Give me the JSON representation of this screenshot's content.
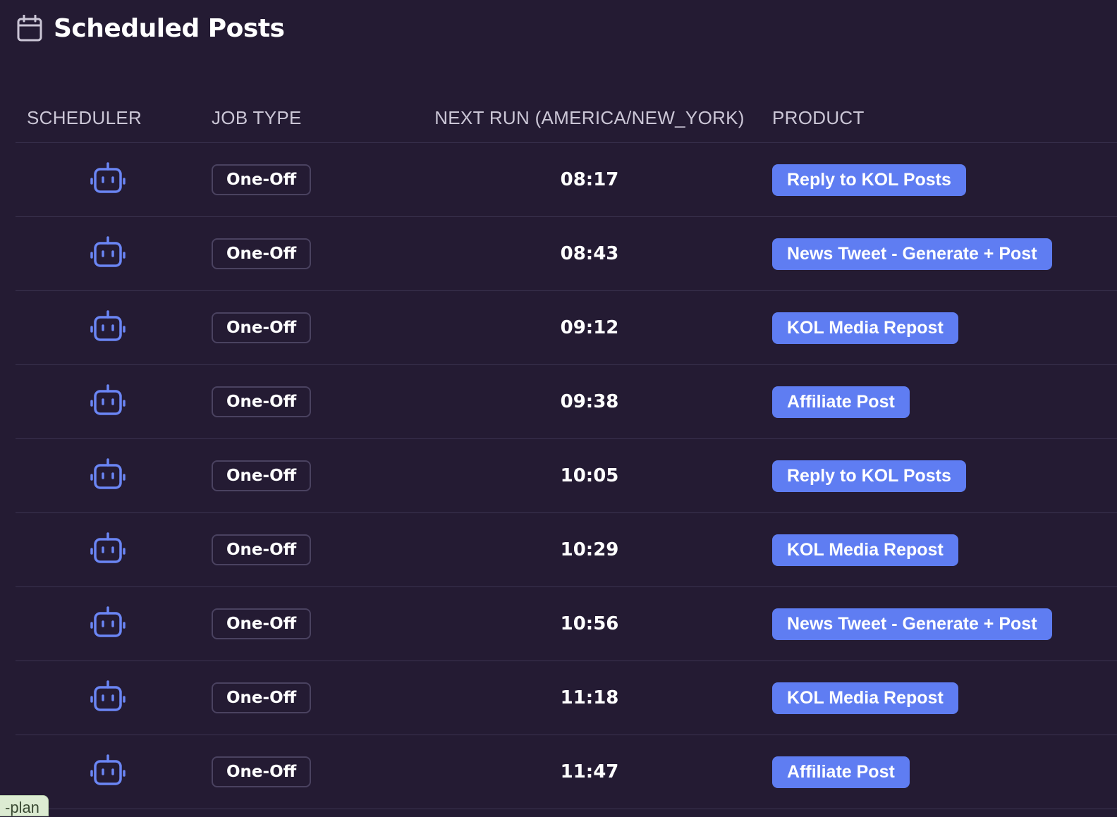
{
  "header": {
    "title": "Scheduled Posts",
    "icon": "calendar-icon"
  },
  "table": {
    "columns": [
      "SCHEDULER",
      "JOB TYPE",
      "NEXT RUN (AMERICA/NEW_YORK)",
      "PRODUCT"
    ],
    "rows": [
      {
        "scheduler_icon": "robot-icon",
        "job_type": "One-Off",
        "next_run": "08:17",
        "product": "Reply to KOL Posts"
      },
      {
        "scheduler_icon": "robot-icon",
        "job_type": "One-Off",
        "next_run": "08:43",
        "product": "News Tweet - Generate + Post"
      },
      {
        "scheduler_icon": "robot-icon",
        "job_type": "One-Off",
        "next_run": "09:12",
        "product": "KOL Media Repost"
      },
      {
        "scheduler_icon": "robot-icon",
        "job_type": "One-Off",
        "next_run": "09:38",
        "product": "Affiliate Post"
      },
      {
        "scheduler_icon": "robot-icon",
        "job_type": "One-Off",
        "next_run": "10:05",
        "product": "Reply to KOL Posts"
      },
      {
        "scheduler_icon": "robot-icon",
        "job_type": "One-Off",
        "next_run": "10:29",
        "product": "KOL Media Repost"
      },
      {
        "scheduler_icon": "robot-icon",
        "job_type": "One-Off",
        "next_run": "10:56",
        "product": "News Tweet - Generate + Post"
      },
      {
        "scheduler_icon": "robot-icon",
        "job_type": "One-Off",
        "next_run": "11:18",
        "product": "KOL Media Repost"
      },
      {
        "scheduler_icon": "robot-icon",
        "job_type": "One-Off",
        "next_run": "11:47",
        "product": "Affiliate Post"
      }
    ]
  },
  "corner_tag": {
    "label": "-plan"
  },
  "colors": {
    "background": "#241b33",
    "accent": "#5f7df2",
    "icon": "#6b86f5",
    "row_divider": "#3b3350"
  }
}
